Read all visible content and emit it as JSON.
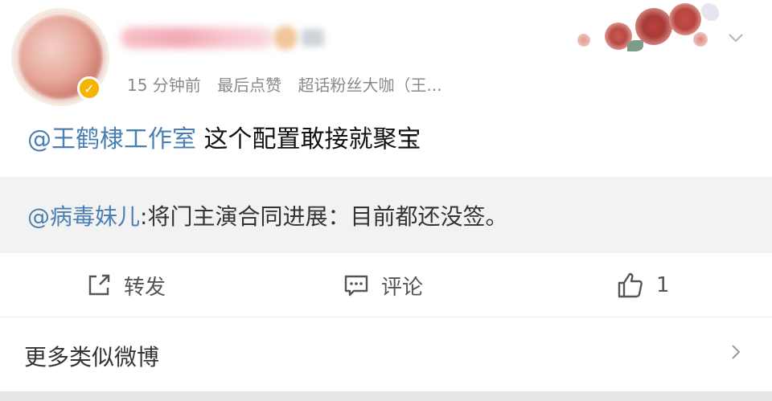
{
  "header": {
    "meta": {
      "time": "15 分钟前",
      "last_action": "最后点赞",
      "topic": "超话粉丝大咖（王..."
    },
    "verified_mark": "✓"
  },
  "post": {
    "mention": "@王鹤棣工作室",
    "text": " 这个配置敢接就聚宝"
  },
  "repost": {
    "mention": "@病毒妹儿",
    "text": ":将门主演合同进展：目前都还没签。"
  },
  "actions": {
    "forward_label": "转发",
    "comment_label": "评论",
    "like_count": "1"
  },
  "more": {
    "label": "更多类似微博"
  },
  "colors": {
    "mention": "#4a7fb3",
    "repost_bg": "#f2f2f2",
    "meta": "#8a8a8a"
  }
}
